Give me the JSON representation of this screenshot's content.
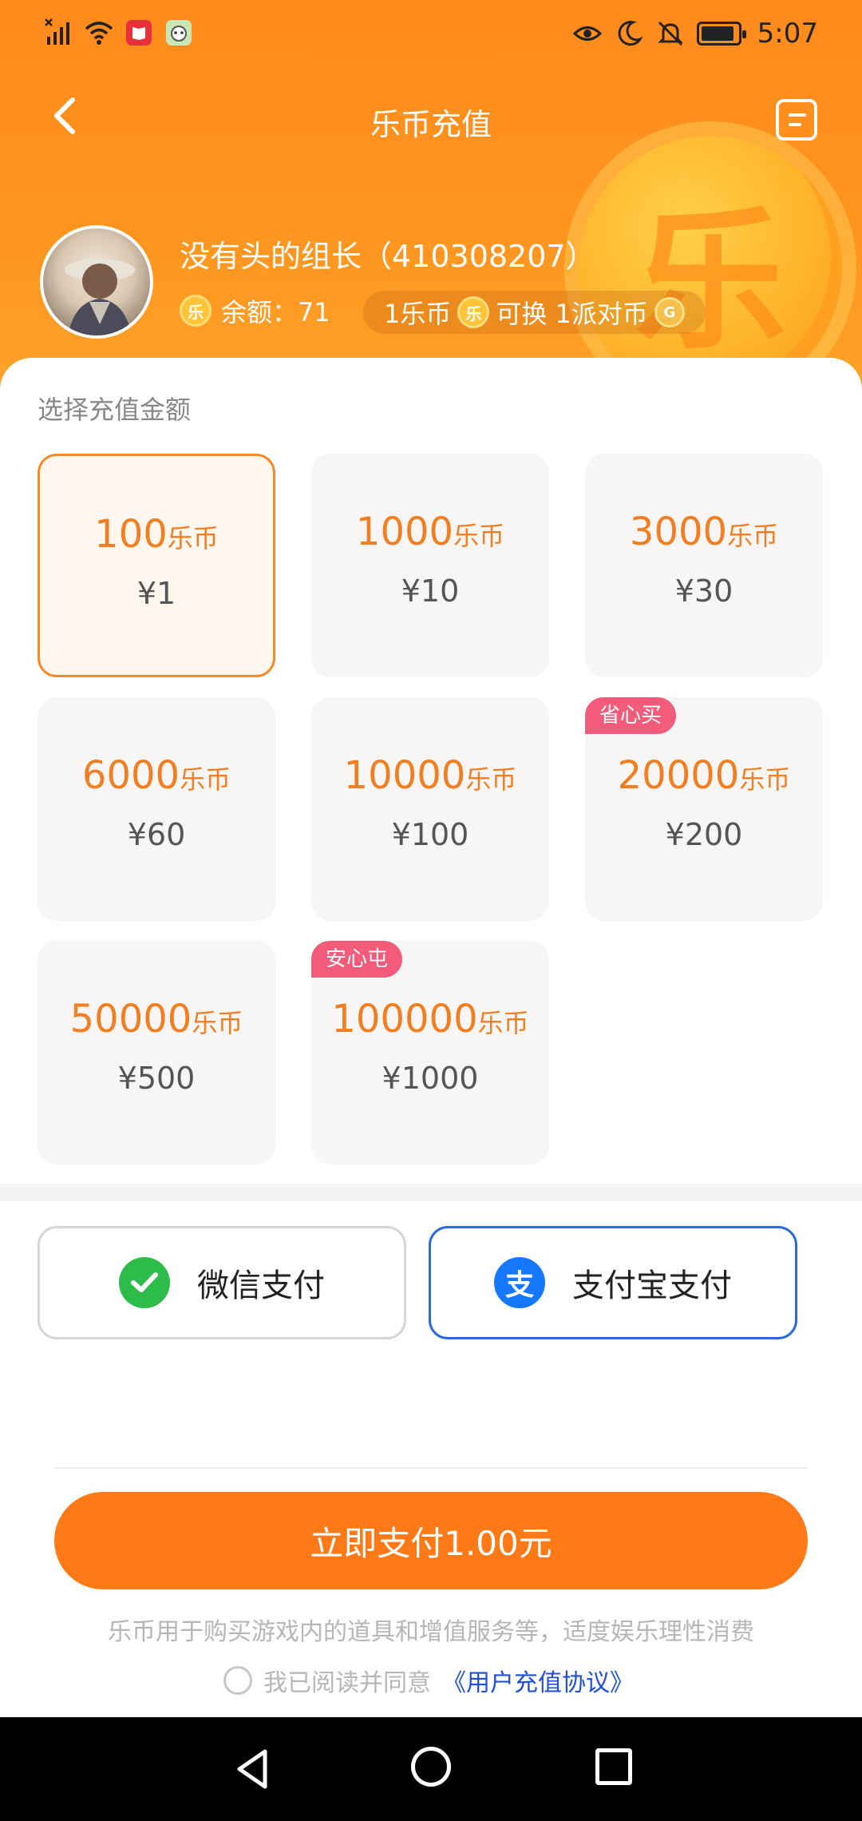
{
  "status_bar": {
    "time": "5:07",
    "icons_left": [
      "no-sim-signal-icon",
      "wifi-icon",
      "book-app-icon",
      "cartoon-app-icon"
    ],
    "icons_right": [
      "eye-comfort-icon",
      "moon-icon",
      "mute-bell-icon",
      "battery-icon"
    ]
  },
  "nav": {
    "title": "乐币充值",
    "back_icon": "chevron-left-icon",
    "record_icon": "record-list-icon"
  },
  "user": {
    "name": "没有头的组长（410308207）",
    "coin_glyph": "乐",
    "balance_text": "余额：71",
    "exchange": {
      "left": "1乐币",
      "mid": "可换 1派对币",
      "party_glyph": "G"
    }
  },
  "section_title": "选择充值金额",
  "unit": "乐币",
  "packages": [
    {
      "amount": "100",
      "price": "¥1",
      "selected": true,
      "tag": ""
    },
    {
      "amount": "1000",
      "price": "¥10",
      "selected": false,
      "tag": ""
    },
    {
      "amount": "3000",
      "price": "¥30",
      "selected": false,
      "tag": ""
    },
    {
      "amount": "6000",
      "price": "¥60",
      "selected": false,
      "tag": ""
    },
    {
      "amount": "10000",
      "price": "¥100",
      "selected": false,
      "tag": ""
    },
    {
      "amount": "20000",
      "price": "¥200",
      "selected": false,
      "tag": "省心买"
    },
    {
      "amount": "50000",
      "price": "¥500",
      "selected": false,
      "tag": ""
    },
    {
      "amount": "100000",
      "price": "¥1000",
      "selected": false,
      "tag": "安心屯"
    }
  ],
  "payment": {
    "wechat_label": "微信支付",
    "alipay_label": "支付宝支付",
    "alipay_glyph": "支",
    "selected": "alipay"
  },
  "submit_label": "立即支付1.00元",
  "notice": "乐币用于购买游戏内的道具和增值服务等，适度娱乐理性消费",
  "agreement": {
    "prefix": "我已阅读并同意",
    "link": "《用户充值协议》",
    "checked": false
  },
  "colors": {
    "brand_orange": "#ff8a1c",
    "price_orange": "#f07e22",
    "tag_pink": "#f25b7a",
    "alipay_blue": "#1677ff",
    "wechat_green": "#2dbb4a"
  }
}
